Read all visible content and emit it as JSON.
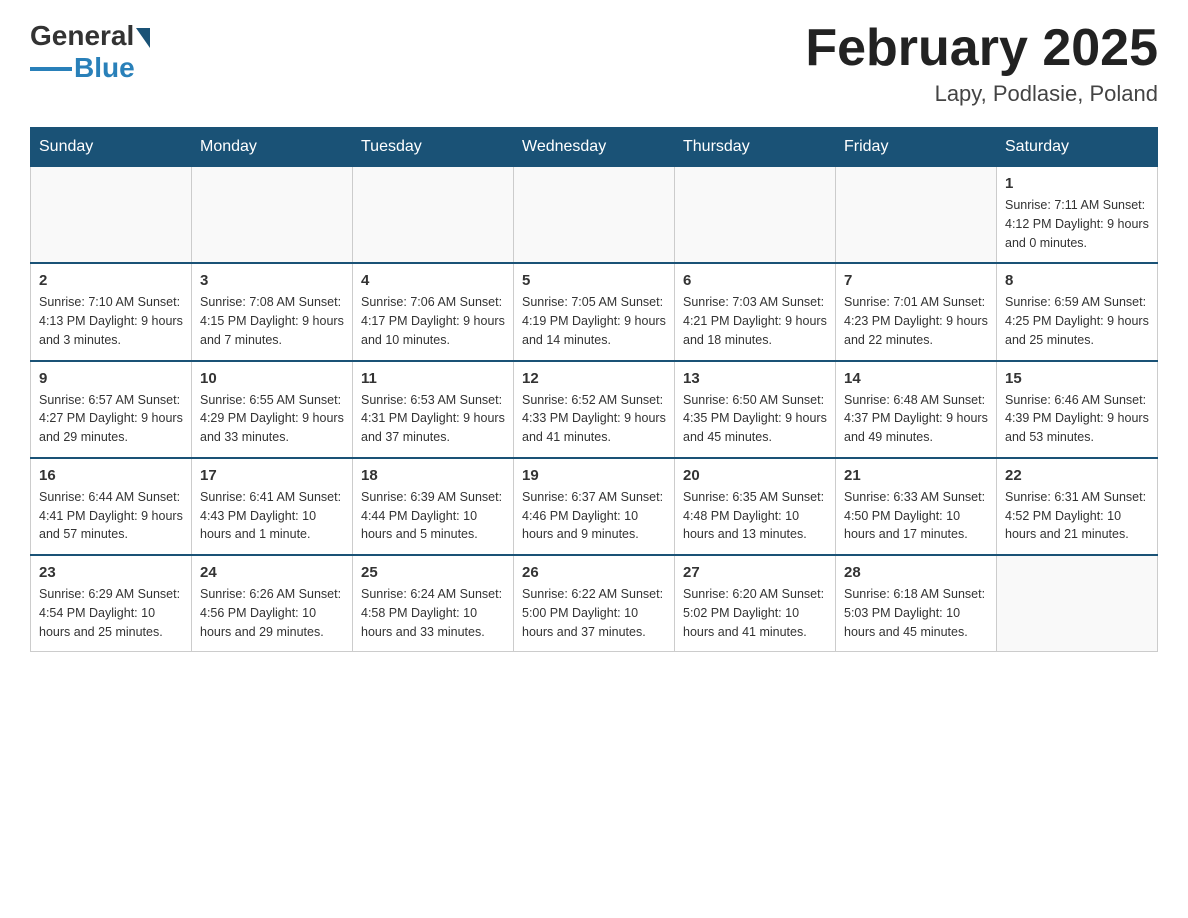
{
  "header": {
    "logo_general": "General",
    "logo_blue": "Blue",
    "month_title": "February 2025",
    "location": "Lapy, Podlasie, Poland"
  },
  "weekdays": [
    "Sunday",
    "Monday",
    "Tuesday",
    "Wednesday",
    "Thursday",
    "Friday",
    "Saturday"
  ],
  "weeks": [
    {
      "days": [
        {
          "num": "",
          "info": ""
        },
        {
          "num": "",
          "info": ""
        },
        {
          "num": "",
          "info": ""
        },
        {
          "num": "",
          "info": ""
        },
        {
          "num": "",
          "info": ""
        },
        {
          "num": "",
          "info": ""
        },
        {
          "num": "1",
          "info": "Sunrise: 7:11 AM\nSunset: 4:12 PM\nDaylight: 9 hours and 0 minutes."
        }
      ]
    },
    {
      "days": [
        {
          "num": "2",
          "info": "Sunrise: 7:10 AM\nSunset: 4:13 PM\nDaylight: 9 hours and 3 minutes."
        },
        {
          "num": "3",
          "info": "Sunrise: 7:08 AM\nSunset: 4:15 PM\nDaylight: 9 hours and 7 minutes."
        },
        {
          "num": "4",
          "info": "Sunrise: 7:06 AM\nSunset: 4:17 PM\nDaylight: 9 hours and 10 minutes."
        },
        {
          "num": "5",
          "info": "Sunrise: 7:05 AM\nSunset: 4:19 PM\nDaylight: 9 hours and 14 minutes."
        },
        {
          "num": "6",
          "info": "Sunrise: 7:03 AM\nSunset: 4:21 PM\nDaylight: 9 hours and 18 minutes."
        },
        {
          "num": "7",
          "info": "Sunrise: 7:01 AM\nSunset: 4:23 PM\nDaylight: 9 hours and 22 minutes."
        },
        {
          "num": "8",
          "info": "Sunrise: 6:59 AM\nSunset: 4:25 PM\nDaylight: 9 hours and 25 minutes."
        }
      ]
    },
    {
      "days": [
        {
          "num": "9",
          "info": "Sunrise: 6:57 AM\nSunset: 4:27 PM\nDaylight: 9 hours and 29 minutes."
        },
        {
          "num": "10",
          "info": "Sunrise: 6:55 AM\nSunset: 4:29 PM\nDaylight: 9 hours and 33 minutes."
        },
        {
          "num": "11",
          "info": "Sunrise: 6:53 AM\nSunset: 4:31 PM\nDaylight: 9 hours and 37 minutes."
        },
        {
          "num": "12",
          "info": "Sunrise: 6:52 AM\nSunset: 4:33 PM\nDaylight: 9 hours and 41 minutes."
        },
        {
          "num": "13",
          "info": "Sunrise: 6:50 AM\nSunset: 4:35 PM\nDaylight: 9 hours and 45 minutes."
        },
        {
          "num": "14",
          "info": "Sunrise: 6:48 AM\nSunset: 4:37 PM\nDaylight: 9 hours and 49 minutes."
        },
        {
          "num": "15",
          "info": "Sunrise: 6:46 AM\nSunset: 4:39 PM\nDaylight: 9 hours and 53 minutes."
        }
      ]
    },
    {
      "days": [
        {
          "num": "16",
          "info": "Sunrise: 6:44 AM\nSunset: 4:41 PM\nDaylight: 9 hours and 57 minutes."
        },
        {
          "num": "17",
          "info": "Sunrise: 6:41 AM\nSunset: 4:43 PM\nDaylight: 10 hours and 1 minute."
        },
        {
          "num": "18",
          "info": "Sunrise: 6:39 AM\nSunset: 4:44 PM\nDaylight: 10 hours and 5 minutes."
        },
        {
          "num": "19",
          "info": "Sunrise: 6:37 AM\nSunset: 4:46 PM\nDaylight: 10 hours and 9 minutes."
        },
        {
          "num": "20",
          "info": "Sunrise: 6:35 AM\nSunset: 4:48 PM\nDaylight: 10 hours and 13 minutes."
        },
        {
          "num": "21",
          "info": "Sunrise: 6:33 AM\nSunset: 4:50 PM\nDaylight: 10 hours and 17 minutes."
        },
        {
          "num": "22",
          "info": "Sunrise: 6:31 AM\nSunset: 4:52 PM\nDaylight: 10 hours and 21 minutes."
        }
      ]
    },
    {
      "days": [
        {
          "num": "23",
          "info": "Sunrise: 6:29 AM\nSunset: 4:54 PM\nDaylight: 10 hours and 25 minutes."
        },
        {
          "num": "24",
          "info": "Sunrise: 6:26 AM\nSunset: 4:56 PM\nDaylight: 10 hours and 29 minutes."
        },
        {
          "num": "25",
          "info": "Sunrise: 6:24 AM\nSunset: 4:58 PM\nDaylight: 10 hours and 33 minutes."
        },
        {
          "num": "26",
          "info": "Sunrise: 6:22 AM\nSunset: 5:00 PM\nDaylight: 10 hours and 37 minutes."
        },
        {
          "num": "27",
          "info": "Sunrise: 6:20 AM\nSunset: 5:02 PM\nDaylight: 10 hours and 41 minutes."
        },
        {
          "num": "28",
          "info": "Sunrise: 6:18 AM\nSunset: 5:03 PM\nDaylight: 10 hours and 45 minutes."
        },
        {
          "num": "",
          "info": ""
        }
      ]
    }
  ]
}
